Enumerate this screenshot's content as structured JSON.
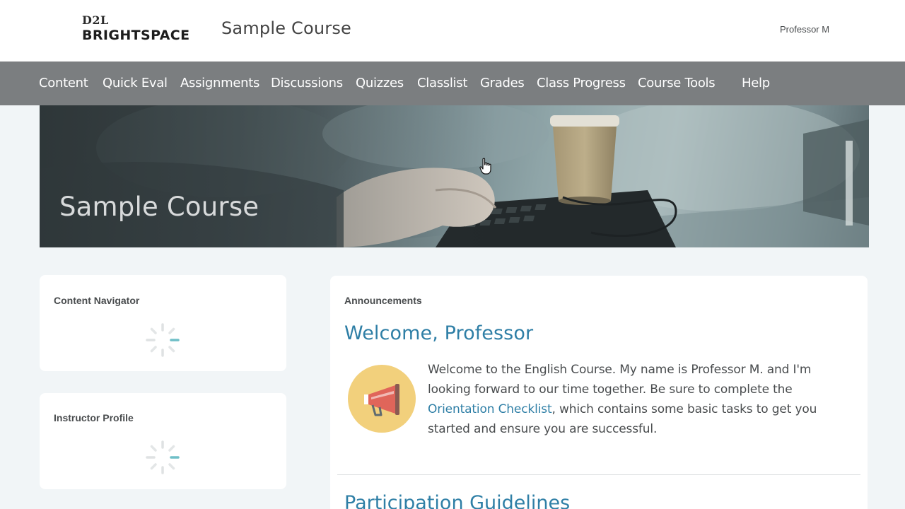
{
  "header": {
    "logo_top": "D2L",
    "logo_bottom": "BRIGHTSPACE",
    "course_title": "Sample Course",
    "user_name": "Professor M"
  },
  "nav": {
    "items": [
      "Content",
      "Quick Eval",
      "Assignments",
      "Discussions",
      "Quizzes",
      "Classlist",
      "Grades",
      "Class Progress",
      "Course Tools",
      "Help"
    ]
  },
  "banner": {
    "title": "Sample Course"
  },
  "widgets": {
    "content_navigator": {
      "title": "Content Navigator"
    },
    "instructor_profile": {
      "title": "Instructor Profile"
    }
  },
  "announcements": {
    "title": "Announcements",
    "heading": "Welcome, Professor",
    "text_before": "Welcome to the English Course. My name is Professor M. and I'm looking forward to our time together. Be sure to complete the ",
    "link": "Orientation Checklist",
    "text_after": ", which contains some basic tasks to get you started and ensure you are successful.",
    "next_heading": "Participation Guidelines"
  },
  "colors": {
    "nav_bg": "#7b7e80",
    "link": "#2f7fa6",
    "page_bg": "#f1f5f7",
    "spinner_accent": "#6fbfc7",
    "megaphone_bg": "#f2d07c",
    "megaphone_body": "#e0655a"
  },
  "icons": {
    "spinner": "loading-spinner-icon",
    "megaphone": "megaphone-icon",
    "cursor": "hand-pointer-icon"
  }
}
